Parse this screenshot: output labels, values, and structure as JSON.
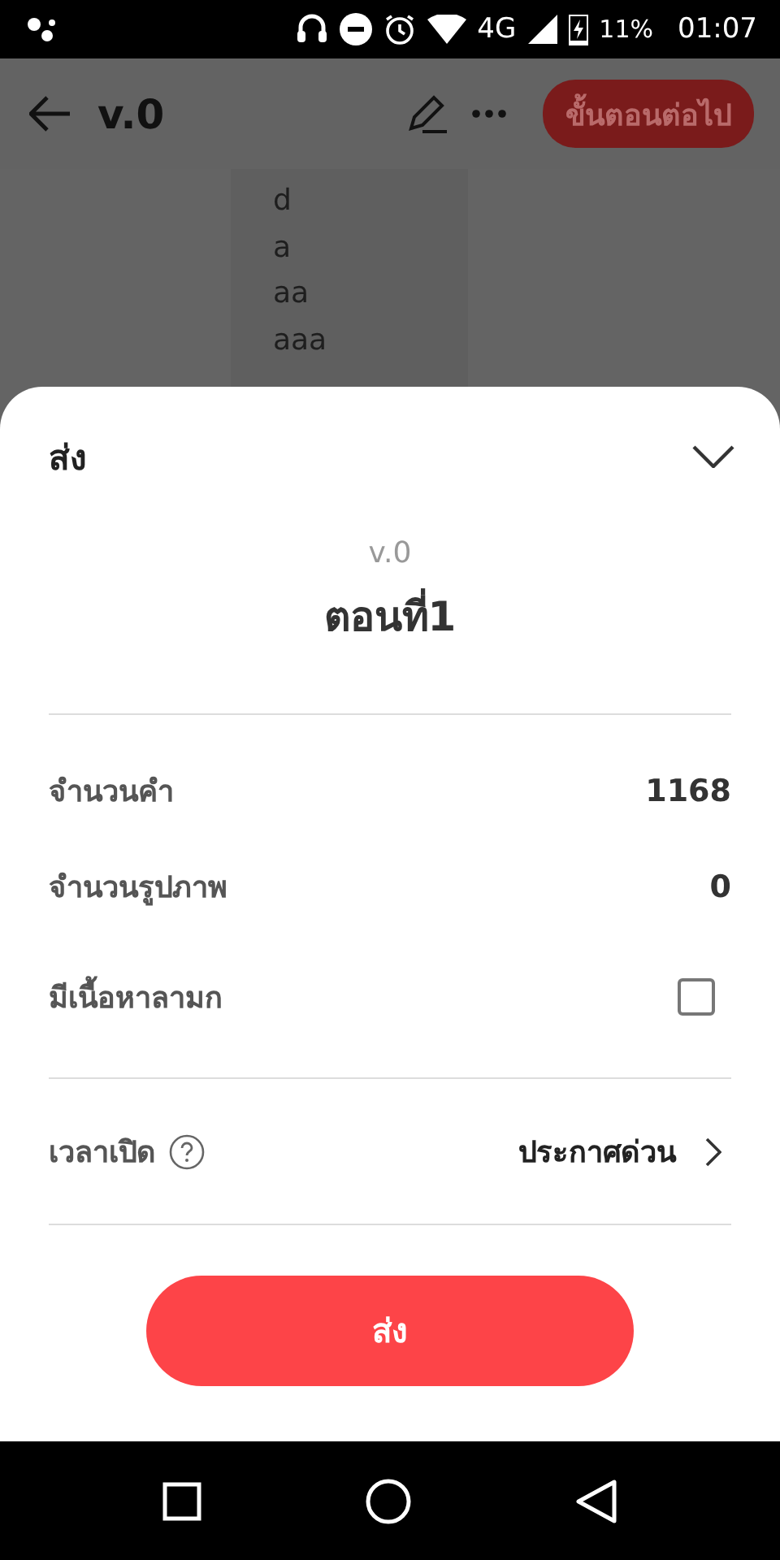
{
  "status_bar": {
    "network": "4G",
    "battery": "11%",
    "time": "01:07"
  },
  "app_bar": {
    "title": "v.0",
    "next_button": "ขั้นตอนต่อไป"
  },
  "background_lines": [
    "d",
    "a",
    "aa",
    "aaa"
  ],
  "sheet": {
    "title": "ส่ง",
    "version": "v.0",
    "episode": "ตอนที่1",
    "rows": [
      {
        "kind": "count",
        "label": "จำนวนคำ",
        "value": "1168"
      },
      {
        "kind": "count",
        "label": "จำนวนรูปภาพ",
        "value": "0"
      },
      {
        "kind": "checkbox",
        "label": "มีเนื้อหาลามก",
        "checked": false
      }
    ],
    "schedule": {
      "label": "เวลาเปิด",
      "value": "ประกาศด่วน"
    },
    "submit_button": "ส่ง"
  }
}
